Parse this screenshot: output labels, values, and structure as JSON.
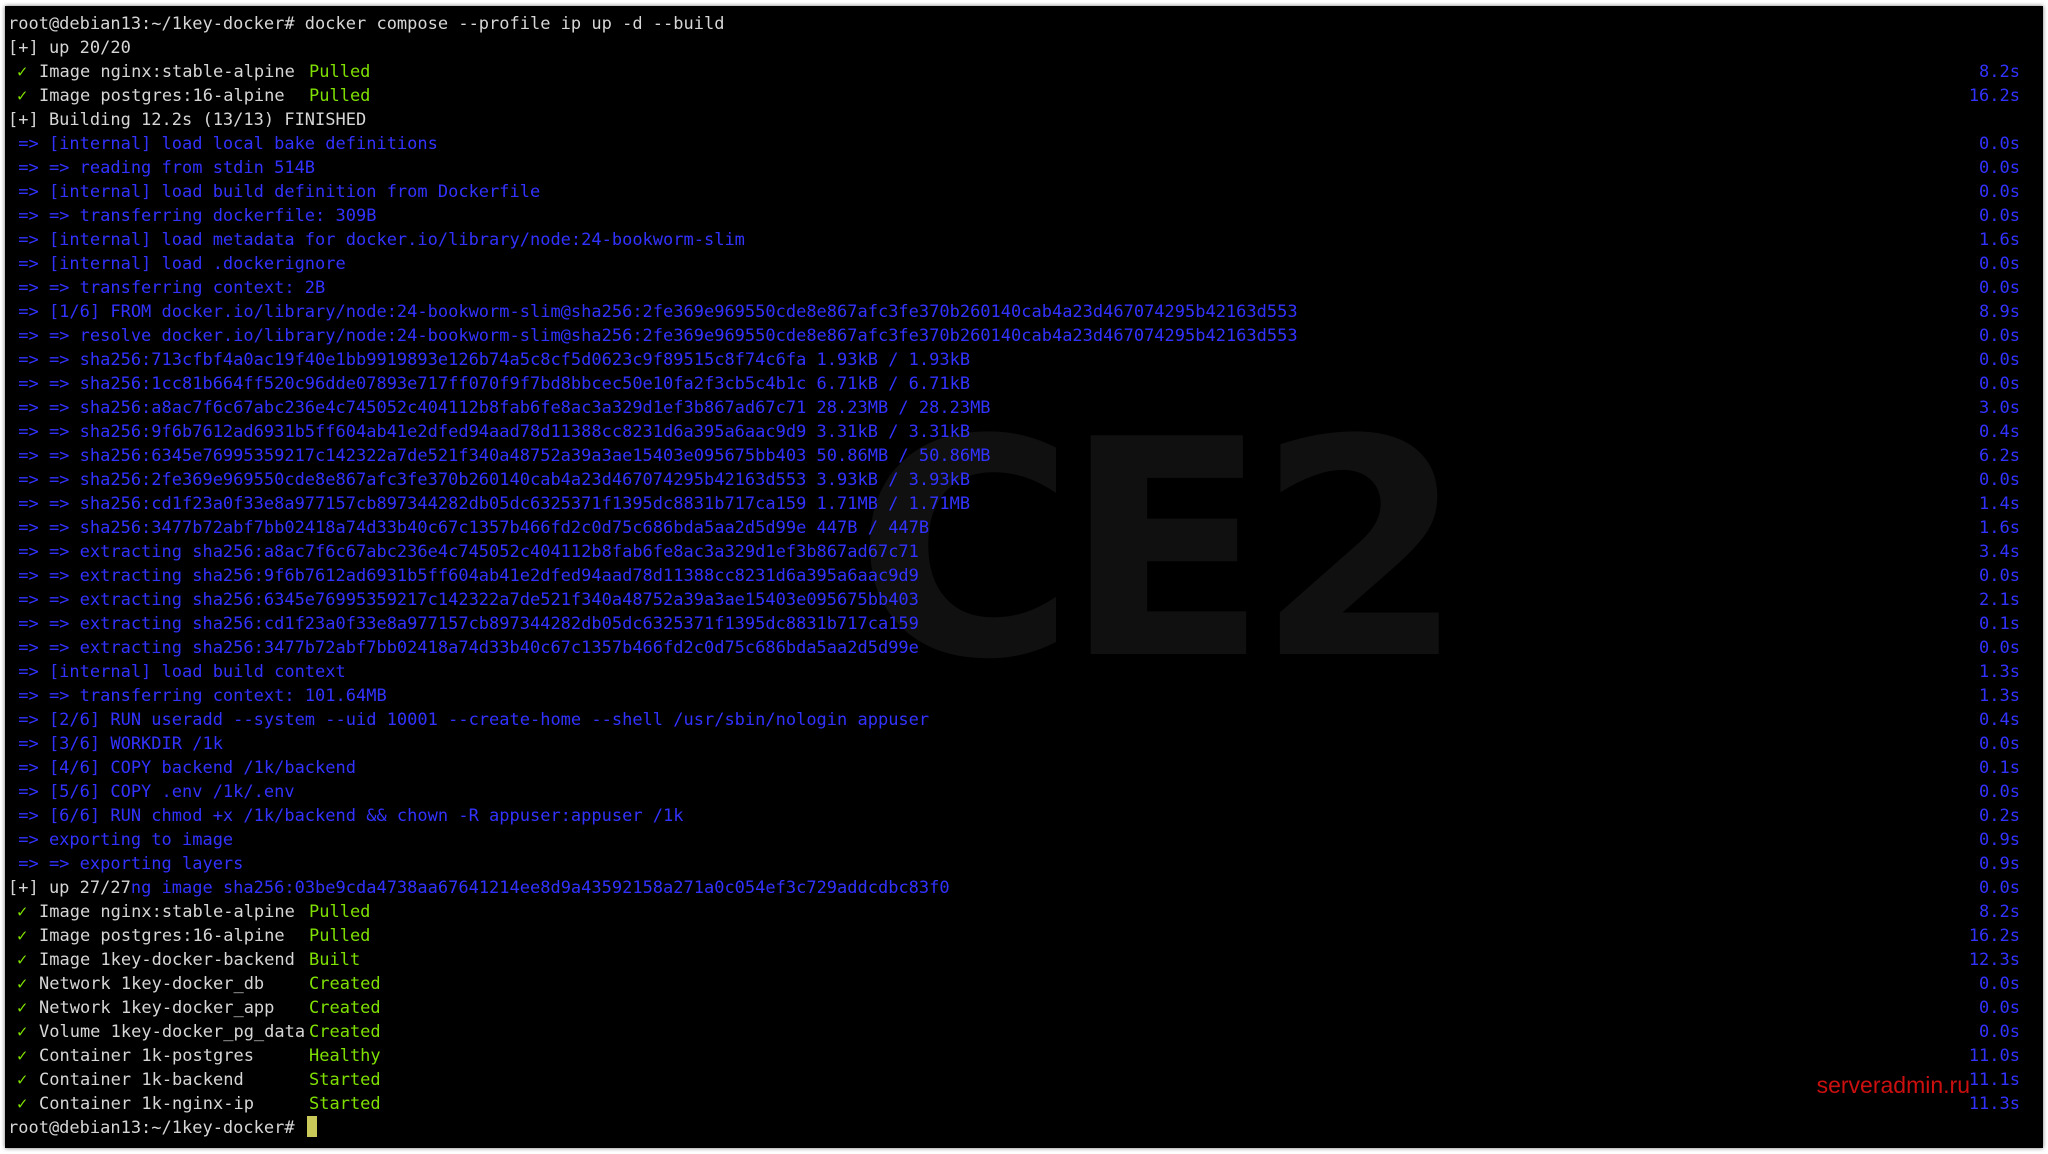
{
  "window": {
    "background": "#000000",
    "colors": {
      "text": "#d6d6d6",
      "build": "#3232ff",
      "success": "#7fe000",
      "cursor": "#c9c95a",
      "watermark": "#cc0f0f"
    }
  },
  "watermark_text": "CE2",
  "site_watermark": "serveradmin.ru",
  "lines": [
    {
      "style": "white",
      "text": "root@debian13:~/1key-docker# docker compose --profile ip up -d --build",
      "time": ""
    },
    {
      "style": "white",
      "text": "[+] up 20/20",
      "time": ""
    },
    {
      "style": "summary",
      "icon": "✓",
      "name": "Image nginx:stable-alpine",
      "status": "Pulled",
      "time": "8.2s"
    },
    {
      "style": "summary",
      "icon": "✓",
      "name": "Image postgres:16-alpine",
      "status": "Pulled",
      "time": "16.2s"
    },
    {
      "style": "white",
      "text": "[+] Building 12.2s (13/13) FINISHED",
      "time": ""
    },
    {
      "style": "blue",
      "text": " => [internal] load local bake definitions",
      "time": "0.0s"
    },
    {
      "style": "blue",
      "text": " => => reading from stdin 514B",
      "time": "0.0s"
    },
    {
      "style": "blue",
      "text": " => [internal] load build definition from Dockerfile",
      "time": "0.0s"
    },
    {
      "style": "blue",
      "text": " => => transferring dockerfile: 309B",
      "time": "0.0s"
    },
    {
      "style": "blue",
      "text": " => [internal] load metadata for docker.io/library/node:24-bookworm-slim",
      "time": "1.6s"
    },
    {
      "style": "blue",
      "text": " => [internal] load .dockerignore",
      "time": "0.0s"
    },
    {
      "style": "blue",
      "text": " => => transferring context: 2B",
      "time": "0.0s"
    },
    {
      "style": "blue",
      "text": " => [1/6] FROM docker.io/library/node:24-bookworm-slim@sha256:2fe369e969550cde8e867afc3fe370b260140cab4a23d467074295b42163d553",
      "time": "8.9s"
    },
    {
      "style": "blue",
      "text": " => => resolve docker.io/library/node:24-bookworm-slim@sha256:2fe369e969550cde8e867afc3fe370b260140cab4a23d467074295b42163d553",
      "time": "0.0s"
    },
    {
      "style": "blue",
      "text": " => => sha256:713cfbf4a0ac19f40e1bb9919893e126b74a5c8cf5d0623c9f89515c8f74c6fa 1.93kB / 1.93kB",
      "time": "0.0s"
    },
    {
      "style": "blue",
      "text": " => => sha256:1cc81b664ff520c96dde07893e717ff070f9f7bd8bbcec50e10fa2f3cb5c4b1c 6.71kB / 6.71kB",
      "time": "0.0s"
    },
    {
      "style": "blue",
      "text": " => => sha256:a8ac7f6c67abc236e4c745052c404112b8fab6fe8ac3a329d1ef3b867ad67c71 28.23MB / 28.23MB",
      "time": "3.0s"
    },
    {
      "style": "blue",
      "text": " => => sha256:9f6b7612ad6931b5ff604ab41e2dfed94aad78d11388cc8231d6a395a6aac9d9 3.31kB / 3.31kB",
      "time": "0.4s"
    },
    {
      "style": "blue",
      "text": " => => sha256:6345e76995359217c142322a7de521f340a48752a39a3ae15403e095675bb403 50.86MB / 50.86MB",
      "time": "6.2s"
    },
    {
      "style": "blue",
      "text": " => => sha256:2fe369e969550cde8e867afc3fe370b260140cab4a23d467074295b42163d553 3.93kB / 3.93kB",
      "time": "0.0s"
    },
    {
      "style": "blue",
      "text": " => => sha256:cd1f23a0f33e8a977157cb897344282db05dc6325371f1395dc8831b717ca159 1.71MB / 1.71MB",
      "time": "1.4s"
    },
    {
      "style": "blue",
      "text": " => => sha256:3477b72abf7bb02418a74d33b40c67c1357b466fd2c0d75c686bda5aa2d5d99e 447B / 447B",
      "time": "1.6s"
    },
    {
      "style": "blue",
      "text": " => => extracting sha256:a8ac7f6c67abc236e4c745052c404112b8fab6fe8ac3a329d1ef3b867ad67c71",
      "time": "3.4s"
    },
    {
      "style": "blue",
      "text": " => => extracting sha256:9f6b7612ad6931b5ff604ab41e2dfed94aad78d11388cc8231d6a395a6aac9d9",
      "time": "0.0s"
    },
    {
      "style": "blue",
      "text": " => => extracting sha256:6345e76995359217c142322a7de521f340a48752a39a3ae15403e095675bb403",
      "time": "2.1s"
    },
    {
      "style": "blue",
      "text": " => => extracting sha256:cd1f23a0f33e8a977157cb897344282db05dc6325371f1395dc8831b717ca159",
      "time": "0.1s"
    },
    {
      "style": "blue",
      "text": " => => extracting sha256:3477b72abf7bb02418a74d33b40c67c1357b466fd2c0d75c686bda5aa2d5d99e",
      "time": "0.0s"
    },
    {
      "style": "blue",
      "text": " => [internal] load build context",
      "time": "1.3s"
    },
    {
      "style": "blue",
      "text": " => => transferring context: 101.64MB",
      "time": "1.3s"
    },
    {
      "style": "blue",
      "text": " => [2/6] RUN useradd --system --uid 10001 --create-home --shell /usr/sbin/nologin appuser",
      "time": "0.4s"
    },
    {
      "style": "blue",
      "text": " => [3/6] WORKDIR /1k",
      "time": "0.0s"
    },
    {
      "style": "blue",
      "text": " => [4/6] COPY backend /1k/backend",
      "time": "0.1s"
    },
    {
      "style": "blue",
      "text": " => [5/6] COPY .env /1k/.env",
      "time": "0.0s"
    },
    {
      "style": "blue",
      "text": " => [6/6] RUN chmod +x /1k/backend && chown -R appuser:appuser /1k",
      "time": "0.2s"
    },
    {
      "style": "blue",
      "text": " => exporting to image",
      "time": "0.9s"
    },
    {
      "style": "blue",
      "text": " => => exporting layers",
      "time": "0.9s"
    },
    {
      "style": "mixed",
      "white": "[+] up 27/27",
      "blue": "ng image sha256:03be9cda4738aa67641214ee8d9a43592158a271a0c054ef3c729addcdbc83f0",
      "time": "0.0s"
    },
    {
      "style": "summary",
      "icon": "✓",
      "name": "Image nginx:stable-alpine",
      "status": "Pulled",
      "time": "8.2s"
    },
    {
      "style": "summary",
      "icon": "✓",
      "name": "Image postgres:16-alpine",
      "status": "Pulled",
      "time": "16.2s"
    },
    {
      "style": "summary",
      "icon": "✓",
      "name": "Image 1key-docker-backend",
      "status": "Built",
      "time": "12.3s"
    },
    {
      "style": "summary",
      "icon": "✓",
      "name": "Network 1key-docker_db",
      "status": "Created",
      "time": "0.0s"
    },
    {
      "style": "summary",
      "icon": "✓",
      "name": "Network 1key-docker_app",
      "status": "Created",
      "time": "0.0s"
    },
    {
      "style": "summary",
      "icon": "✓",
      "name": "Volume 1key-docker_pg_data",
      "status": "Created",
      "time": "0.0s"
    },
    {
      "style": "summary",
      "icon": "✓",
      "name": "Container 1k-postgres",
      "status": "Healthy",
      "time": "11.0s"
    },
    {
      "style": "summary",
      "icon": "✓",
      "name": "Container 1k-backend",
      "status": "Started",
      "time": "11.1s"
    },
    {
      "style": "summary",
      "icon": "✓",
      "name": "Container 1k-nginx-ip",
      "status": "Started",
      "time": "11.3s"
    },
    {
      "style": "prompt",
      "text": "root@debian13:~/1key-docker# ",
      "time": ""
    }
  ]
}
